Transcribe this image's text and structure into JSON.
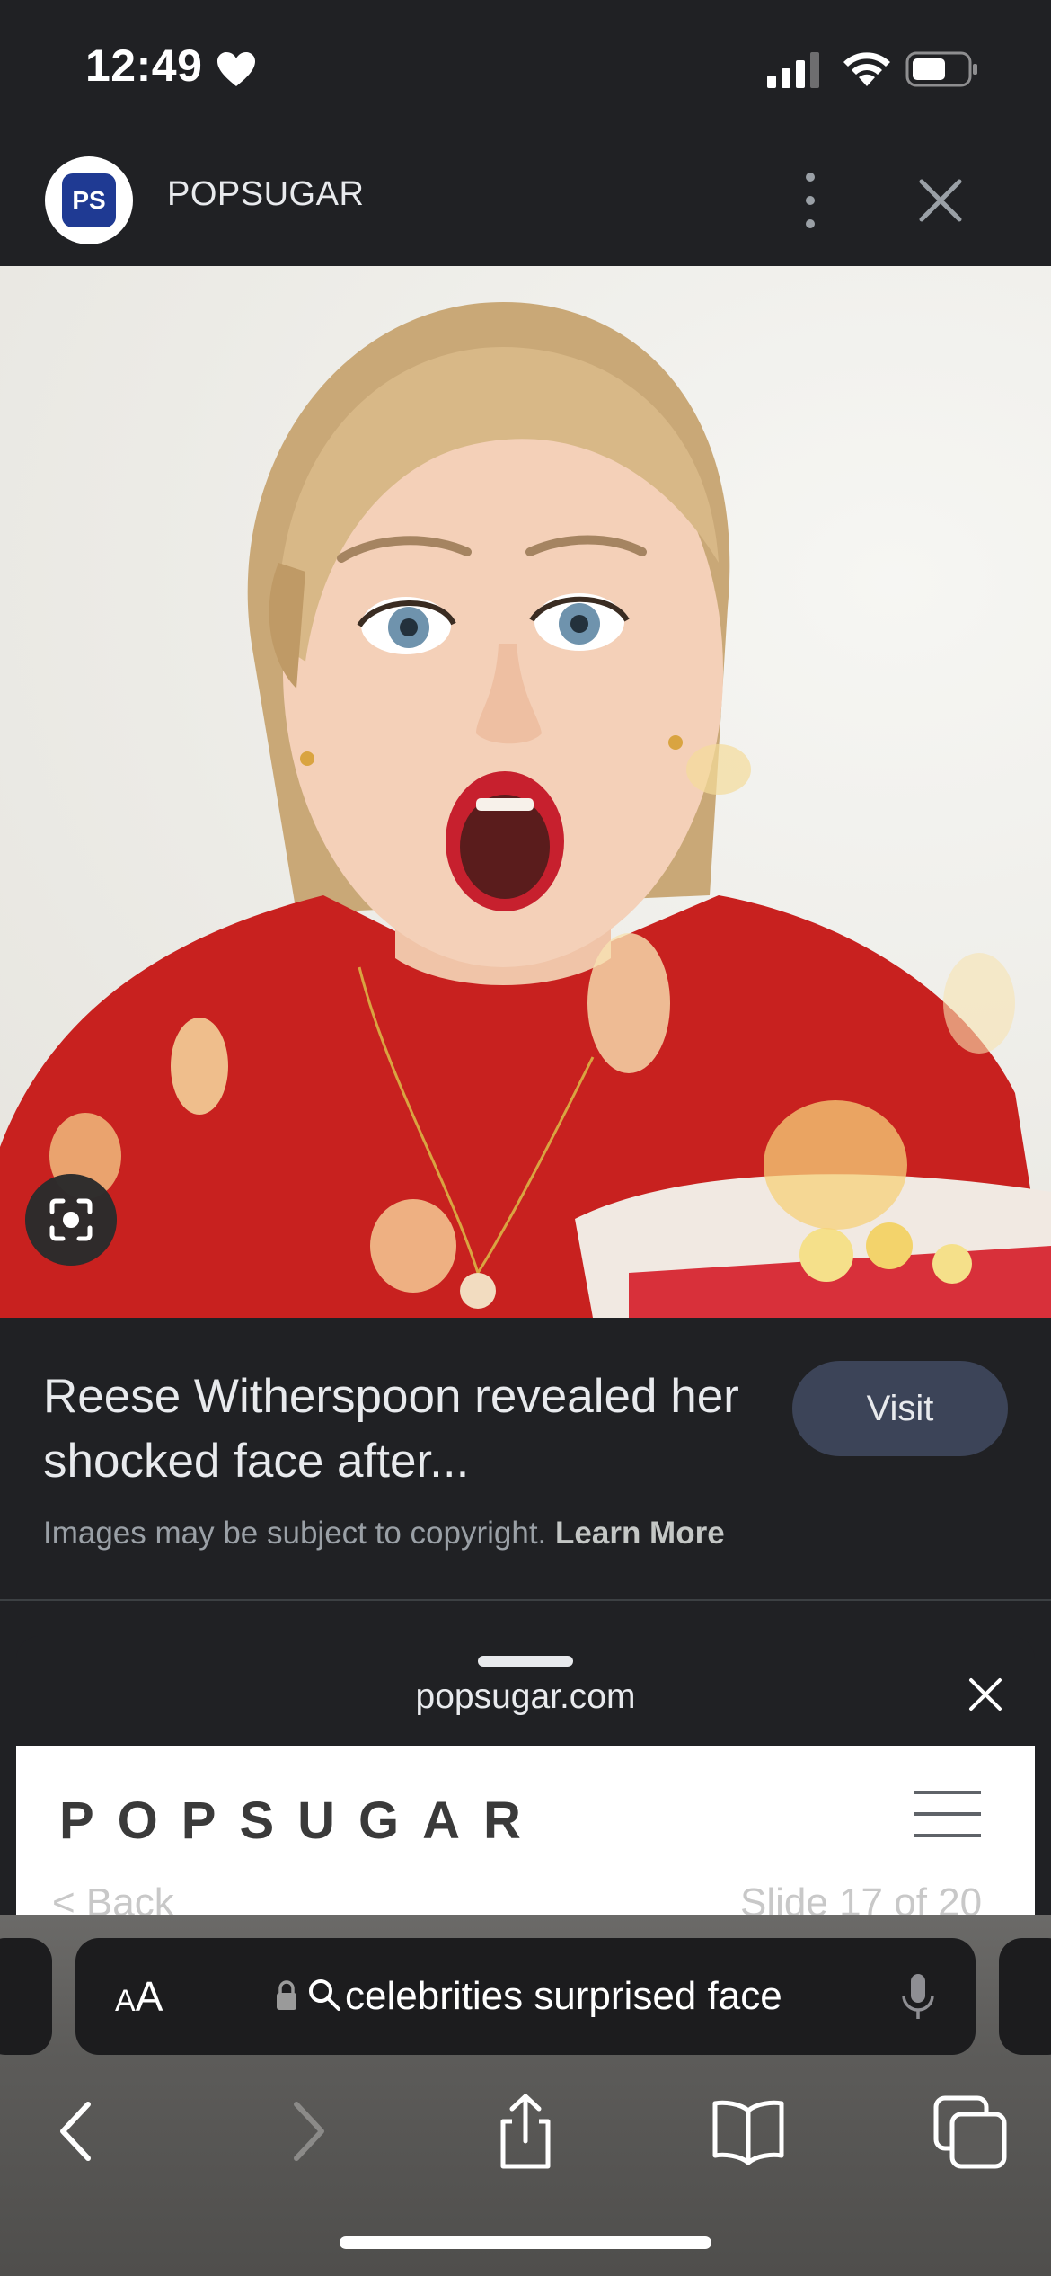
{
  "status_bar": {
    "time": "12:49",
    "icons": [
      "heart-icon",
      "cellular-signal-icon",
      "wifi-icon",
      "battery-icon"
    ]
  },
  "source": {
    "logo_text": "PS",
    "name": "POPSUGAR",
    "icons": [
      "more-vertical-icon",
      "close-icon"
    ]
  },
  "image": {
    "lens_icon": "google-lens-icon"
  },
  "result": {
    "title": "Reese Witherspoon revealed her shocked face after...",
    "visit_label": "Visit",
    "copyright_text": "Images may be subject to copyright.",
    "learn_more_label": "Learn More"
  },
  "preview_sheet": {
    "url": "popsugar.com",
    "site_wordmark": "POPSUGAR",
    "back_label": "< Back",
    "slide_label": "Slide 17 of 20"
  },
  "browser": {
    "text_size_label": "AA",
    "address_text": "celebrities surprised face",
    "toolbar": [
      "back-icon",
      "forward-icon",
      "share-icon",
      "bookmarks-icon",
      "tabs-icon"
    ]
  },
  "colors": {
    "background": "#202124",
    "visit_button": "#3c4458",
    "logo_blue": "#1f3a93",
    "shirt_red": "#c8211f"
  }
}
